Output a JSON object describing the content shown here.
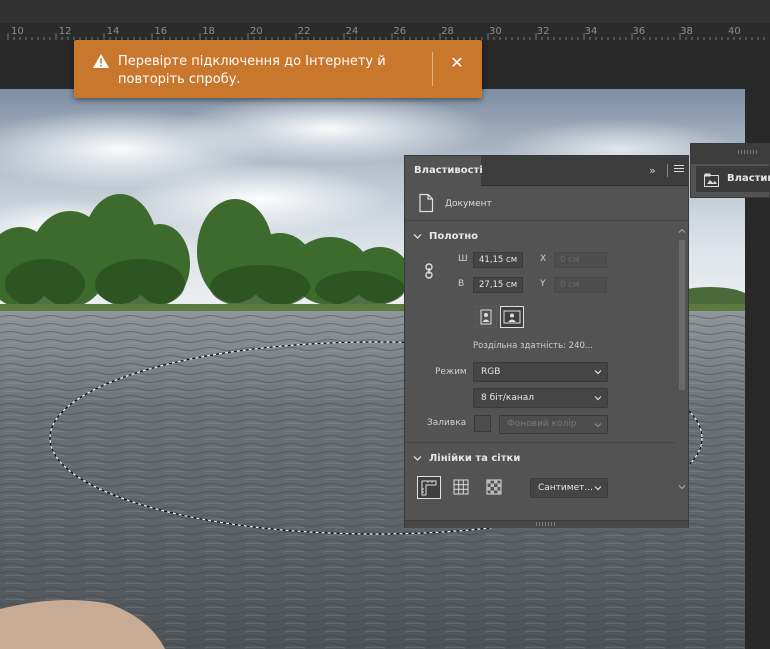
{
  "ruler": {
    "labels": [
      "10",
      "12",
      "14",
      "16",
      "18",
      "20",
      "22",
      "24",
      "26",
      "28",
      "30",
      "32",
      "34",
      "36",
      "38",
      "40"
    ]
  },
  "toast": {
    "message": "Перевірте підключення до Інтернету й повторіть спробу.",
    "icon": "warning-icon",
    "close_icon": "close-icon",
    "color": "#c9772c"
  },
  "properties_panel": {
    "tab_label": "Властивості",
    "document_label": "Документ",
    "canvas_section": {
      "title": "Полотно",
      "width_label": "Ш",
      "width_value": "41,15 см",
      "height_label": "В",
      "height_value": "27,15 см",
      "x_label": "X",
      "x_placeholder": "0 см",
      "y_label": "Y",
      "y_placeholder": "0 см",
      "resolution": "Роздільна здатність:  240...",
      "mode_label": "Режим",
      "mode_value": "RGB",
      "bit_depth": "8 біт/канал",
      "fill_label": "Заливка",
      "fill_value": "Фоновий колір"
    },
    "rulers_section": {
      "title": "Лінійки та сітки",
      "units_value": "Сантимет..."
    }
  },
  "second_panel": {
    "tab_label": "Властивості"
  }
}
